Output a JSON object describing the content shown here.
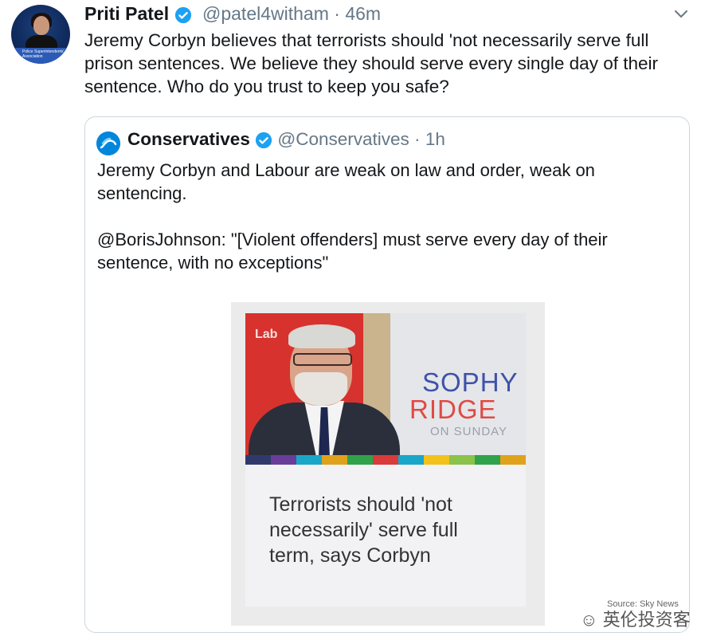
{
  "tweet": {
    "name": "Priti Patel",
    "handle": "@patel4witham",
    "separator": "·",
    "time": "46m",
    "text": "Jeremy Corbyn believes that terrorists should 'not necessarily serve full prison sentences. We believe they should serve every single day of their sentence. Who do you trust to keep you safe?",
    "avatar_banner": "Police Superintendents' Association"
  },
  "quoted": {
    "name": "Conservatives",
    "handle": "@Conservatives",
    "separator": "·",
    "time": "1h",
    "paragraph1": "Jeremy Corbyn and Labour are weak on law and order, weak on sentencing.",
    "paragraph2": "@BorisJohnson: \"[Violent offenders] must serve every day of their sentence, with no exceptions\""
  },
  "media": {
    "show_line1": "SOPHY",
    "show_line2": "RIDGE",
    "show_line3": "ON SUNDAY",
    "wall_text": "Lab",
    "headline": "Terrorists should 'not necessarily' serve full term, says Corbyn",
    "stripe_colors": [
      "#2f3a6b",
      "#6a3d9a",
      "#19a7c9",
      "#e0a21a",
      "#2fa24a",
      "#d93a3a",
      "#19a7c9",
      "#f2c21a",
      "#8ac24a",
      "#2fa24a",
      "#e0a21a"
    ]
  },
  "watermark": {
    "text": "英伦投资客",
    "source": "Source: Sky News"
  },
  "colors": {
    "verified": "#1da1f2",
    "secondary_text": "#657786",
    "border": "#ccd6dd",
    "conservatives_blue": "#0087dc"
  },
  "icons": {
    "verified": "verified-badge-icon",
    "more": "chevron-down-icon",
    "conservatives_logo": "tree-logo-icon"
  }
}
